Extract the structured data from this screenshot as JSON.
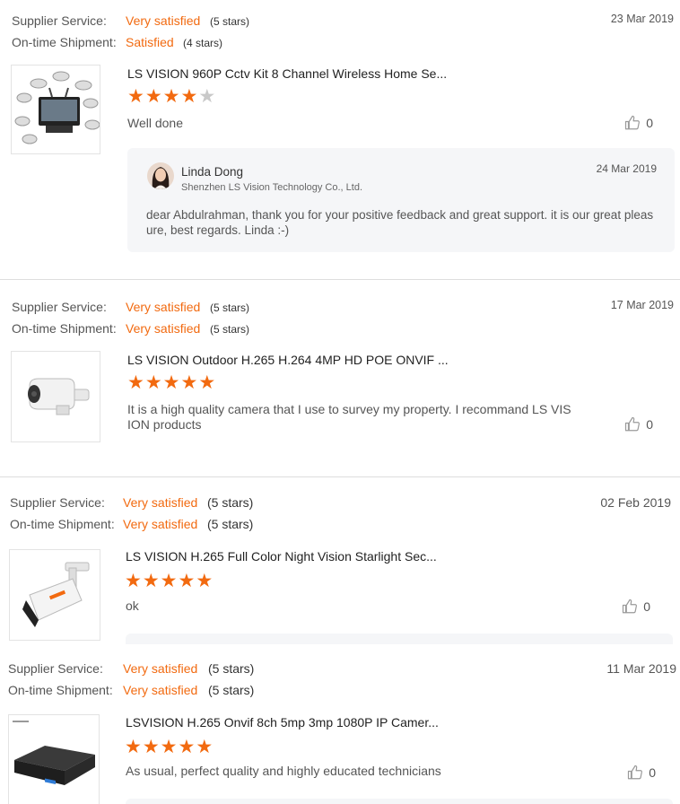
{
  "labels": {
    "supplier": "Supplier Service:",
    "shipment": "On-time Shipment:"
  },
  "reviews": [
    {
      "supplier_rating": "Very satisfied",
      "supplier_stars": "(5 stars)",
      "shipment_rating": "Satisfied",
      "shipment_stars": "(4 stars)",
      "date": "23 Mar 2019",
      "product": "LS VISION 960P Cctv Kit 8 Channel Wireless Home Se...",
      "rating": 4,
      "comment": "Well done",
      "likes": "0",
      "reply": {
        "name": "Linda Dong",
        "company": "Shenzhen LS Vision Technology Co., Ltd.",
        "date": "24 Mar 2019",
        "text": "dear Abdulrahman, thank you for your positive feedback and great support. it is our great pleasure,  best regards. Linda :-)"
      }
    },
    {
      "supplier_rating": "Very satisfied",
      "supplier_stars": "(5 stars)",
      "shipment_rating": "Very satisfied",
      "shipment_stars": "(5 stars)",
      "date": "17 Mar 2019",
      "product": "LS VISION Outdoor H.265 H.264 4MP HD POE ONVIF ...",
      "rating": 5,
      "comment": "It is a high quality camera that I use to survey my property. I recommand LS VISION products",
      "likes": "0"
    },
    {
      "supplier_rating": "Very satisfied",
      "supplier_stars": "(5 stars)",
      "shipment_rating": "Very satisfied",
      "shipment_stars": "(5 stars)",
      "date": "02 Feb 2019",
      "product": "LS VISION H.265 Full Color Night Vision Starlight Sec...",
      "rating": 5,
      "comment": "ok",
      "likes": "0"
    },
    {
      "supplier_rating": "Very satisfied",
      "supplier_stars": "(5 stars)",
      "shipment_rating": "Very satisfied",
      "shipment_stars": "(5 stars)",
      "date": "11 Mar 2019",
      "product": "LSVISION H.265 Onvif 8ch 5mp 3mp 1080P IP Camer...",
      "rating": 5,
      "comment": "As usual, perfect quality and highly educated technicians",
      "likes": "0"
    }
  ],
  "colors": {
    "accent": "#f26a10",
    "star_off": "#c9c9c9",
    "reply_bg": "#f5f6f8"
  },
  "icons": {
    "like": "thumbs-up-icon",
    "star": "star-icon"
  }
}
